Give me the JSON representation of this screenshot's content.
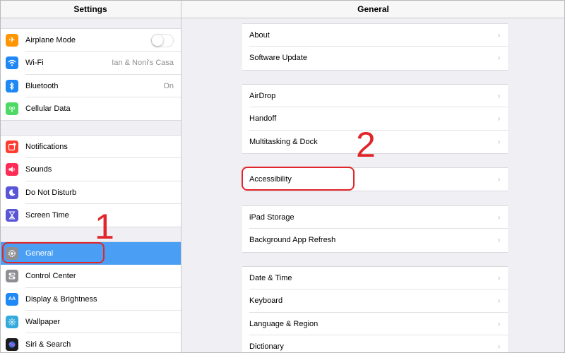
{
  "sidebar": {
    "title": "Settings",
    "groups": [
      [
        {
          "label": "Airplane Mode",
          "icon": "airplane-icon",
          "color": "#ff9500",
          "toggle": false
        },
        {
          "label": "Wi-Fi",
          "icon": "wifi-icon",
          "color": "#1e88f5",
          "value": "Ian & Noni's Casa"
        },
        {
          "label": "Bluetooth",
          "icon": "bluetooth-icon",
          "color": "#1e88f5",
          "value": "On"
        },
        {
          "label": "Cellular Data",
          "icon": "cellular-icon",
          "color": "#4cd964"
        }
      ],
      [
        {
          "label": "Notifications",
          "icon": "notifications-icon",
          "color": "#ff3b30"
        },
        {
          "label": "Sounds",
          "icon": "sounds-icon",
          "color": "#ff2d55"
        },
        {
          "label": "Do Not Disturb",
          "icon": "moon-icon",
          "color": "#5856d6"
        },
        {
          "label": "Screen Time",
          "icon": "hourglass-icon",
          "color": "#5856d6"
        }
      ],
      [
        {
          "label": "General",
          "icon": "gear-icon",
          "color": "#8e8e93",
          "selected": true
        },
        {
          "label": "Control Center",
          "icon": "control-center-icon",
          "color": "#8e8e93"
        },
        {
          "label": "Display & Brightness",
          "icon": "display-icon",
          "color": "#1e88f5"
        },
        {
          "label": "Wallpaper",
          "icon": "wallpaper-icon",
          "color": "#35aadc"
        },
        {
          "label": "Siri & Search",
          "icon": "siri-icon",
          "color": "#1c1c1e"
        }
      ]
    ]
  },
  "main": {
    "title": "General",
    "groups": [
      [
        "About",
        "Software Update"
      ],
      [
        "AirDrop",
        "Handoff",
        "Multitasking & Dock"
      ],
      [
        "Accessibility"
      ],
      [
        "iPad Storage",
        "Background App Refresh"
      ],
      [
        "Date & Time",
        "Keyboard",
        "Language & Region",
        "Dictionary"
      ]
    ]
  },
  "annotations": {
    "step1": "1",
    "step2": "2",
    "color": "#e0262a"
  }
}
